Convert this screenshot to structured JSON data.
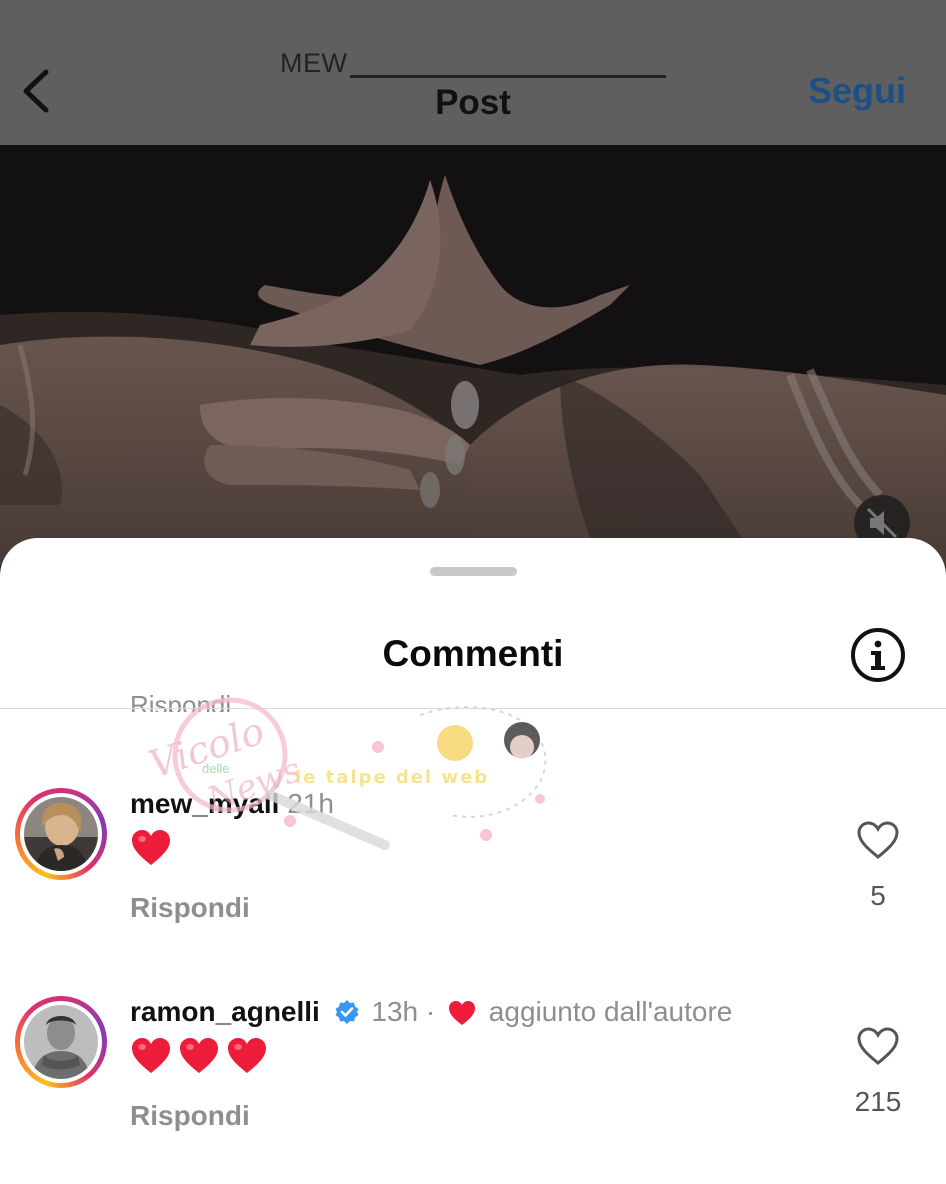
{
  "header": {
    "username": "MEW",
    "title": "Post",
    "follow_label": "Segui"
  },
  "sheet": {
    "title": "Commenti",
    "previous_reply_label": "Rispondi"
  },
  "comments": [
    {
      "username": "mew_myall",
      "time": "21h",
      "verified": false,
      "hearts": 1,
      "reply_label": "Rispondi",
      "likes": "5"
    },
    {
      "username": "ramon_agnelli",
      "time": "13h",
      "verified": true,
      "separator": "·",
      "author_note": "aggiunto dall'autore",
      "hearts": 3,
      "reply_label": "Rispondi",
      "likes": "215"
    }
  ],
  "watermark": {
    "text_1": "Vicolo",
    "text_2": "delle",
    "text_3": "News",
    "text_4": "le talpe del web"
  },
  "colors": {
    "follow": "#1b4f86",
    "heart_red": "#ed1c3a",
    "verified_blue": "#3897f0",
    "muted_text": "#8e8e8e"
  },
  "icons": [
    "back-chevron-icon",
    "mute-icon",
    "info-icon",
    "verified-icon",
    "heart-outline-icon",
    "heart-filled-icon"
  ]
}
